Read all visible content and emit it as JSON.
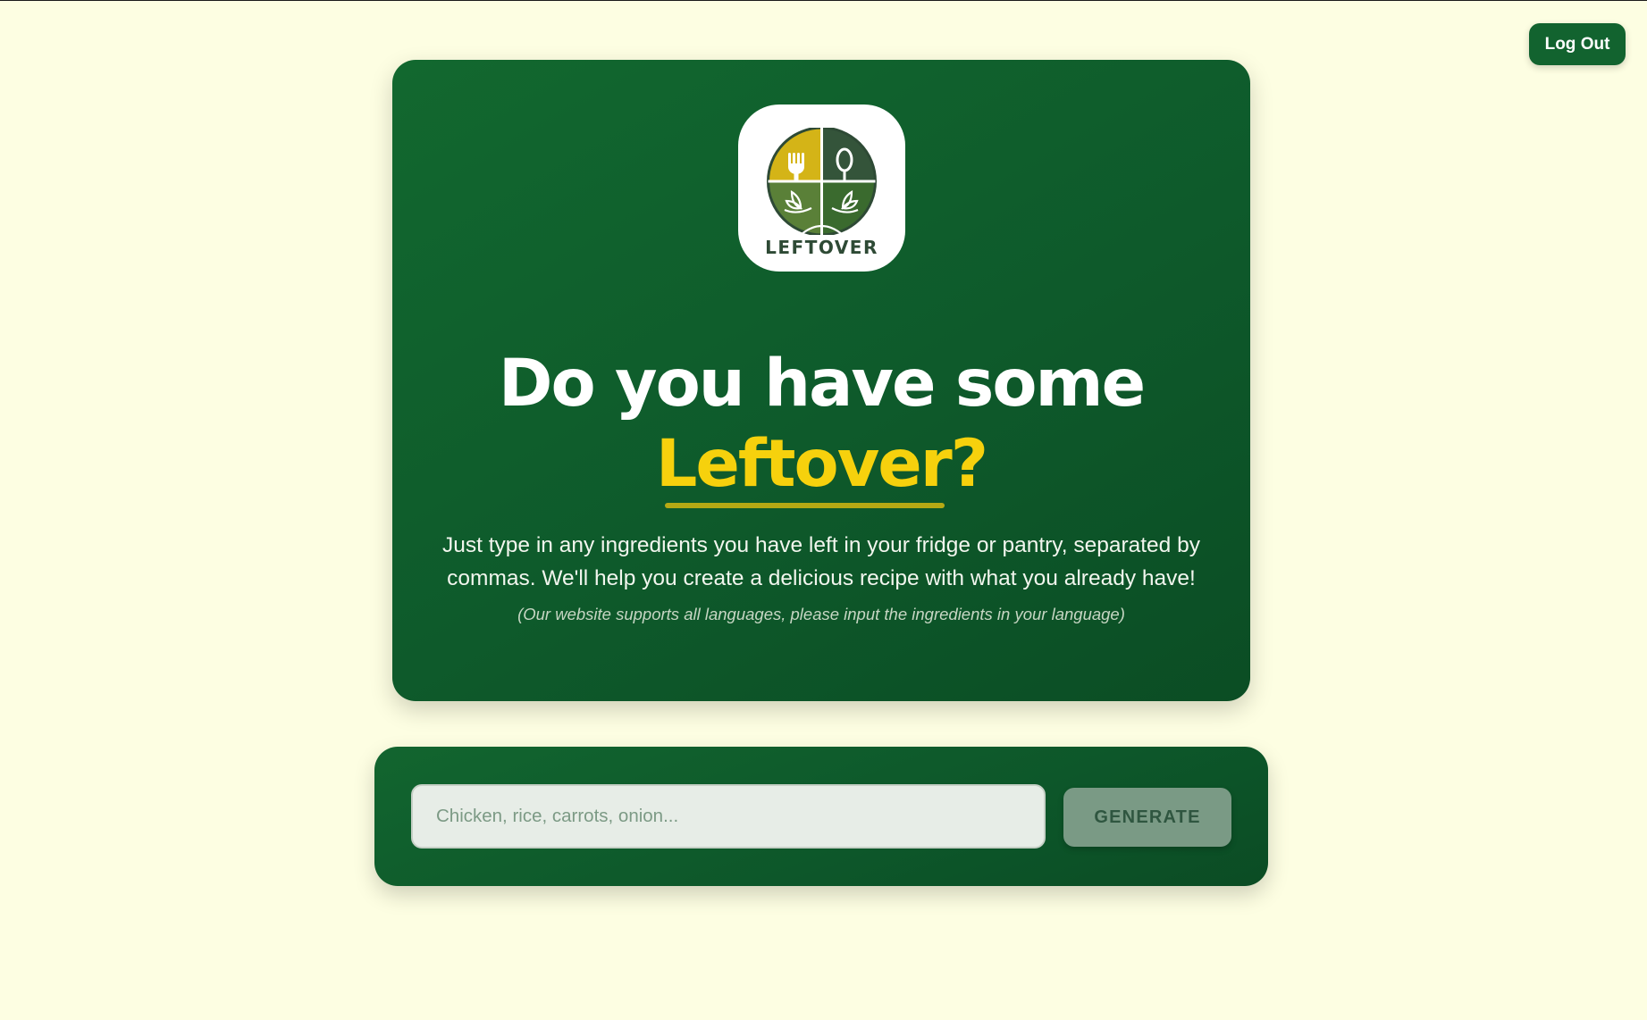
{
  "header": {
    "logout_label": "Log Out"
  },
  "hero": {
    "logo_text": "LEFTOVER",
    "headline": "Do you have some",
    "headline_accent": "Leftover?",
    "description": "Just type in any ingredients you have left in your fridge or pantry, separated by commas. We'll help you create a delicious recipe with what you already have!",
    "note": "(Our website supports all languages, please input the ingredients in your language)"
  },
  "form": {
    "input_value": "",
    "input_placeholder": "Chicken, rice, carrots, onion...",
    "generate_label": "GENERATE"
  },
  "colors": {
    "background": "#fdfee2",
    "primary_green": "#12632f",
    "accent_yellow": "#f6d10d",
    "button_disabled": "#7a9a85"
  }
}
